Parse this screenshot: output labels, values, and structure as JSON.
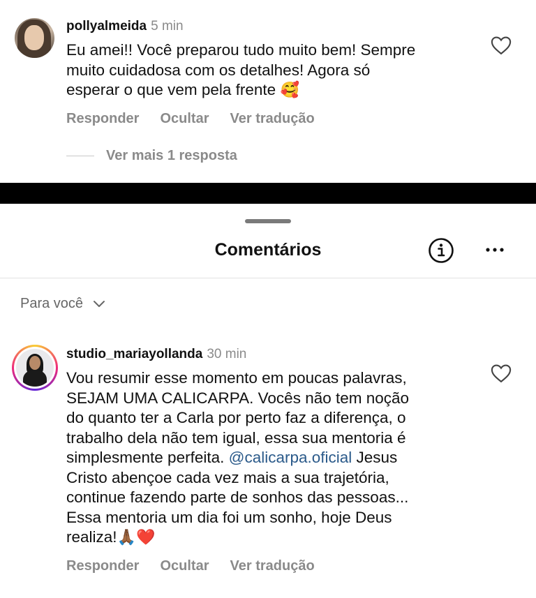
{
  "comment1": {
    "username": "pollyalmeida",
    "time": "5 min",
    "text": "Eu amei!! Você preparou tudo muito bem! Sempre\nmuito cuidadosa com os detalhes! Agora só\nesperar o que vem pela frente",
    "emoji": "🥰",
    "actions": [
      "Responder",
      "Ocultar",
      "Ver tradução"
    ],
    "more_replies": "Ver mais 1 resposta"
  },
  "sheet": {
    "title": "Comentários",
    "filter_label": "Para você"
  },
  "comment2": {
    "username": "studio_mariayollanda",
    "time": "30 min",
    "text_before_mention": "Vou resumir esse momento em poucas palavras,\nSEJAM UMA CALICARPA. Vocês não tem noção\ndo quanto ter a Carla por perto faz a diferença, o\ntrabalho dela não tem igual, essa sua mentoria é\nsimplesmente perfeita. ",
    "mention": "@calicarpa.oficial",
    "text_after_mention": " Jesus\nCristo abençoe cada vez mais a sua trajetória,\ncontinue fazendo parte de sonhos das pessoas...\nEssa mentoria um dia foi um sonho, hoje Deus\nrealiza!",
    "emojis": "🙏🏾❤️",
    "actions": [
      "Responder",
      "Ocultar",
      "Ver tradução"
    ]
  },
  "icons": {
    "heart": "heart-outline-icon",
    "info": "info-circle-icon",
    "more": "more-horizontal-icon",
    "chevron": "chevron-down-icon"
  },
  "colors": {
    "secondary_text": "#8a8a8a",
    "mention": "#2b5a8a",
    "background": "#ffffff"
  }
}
